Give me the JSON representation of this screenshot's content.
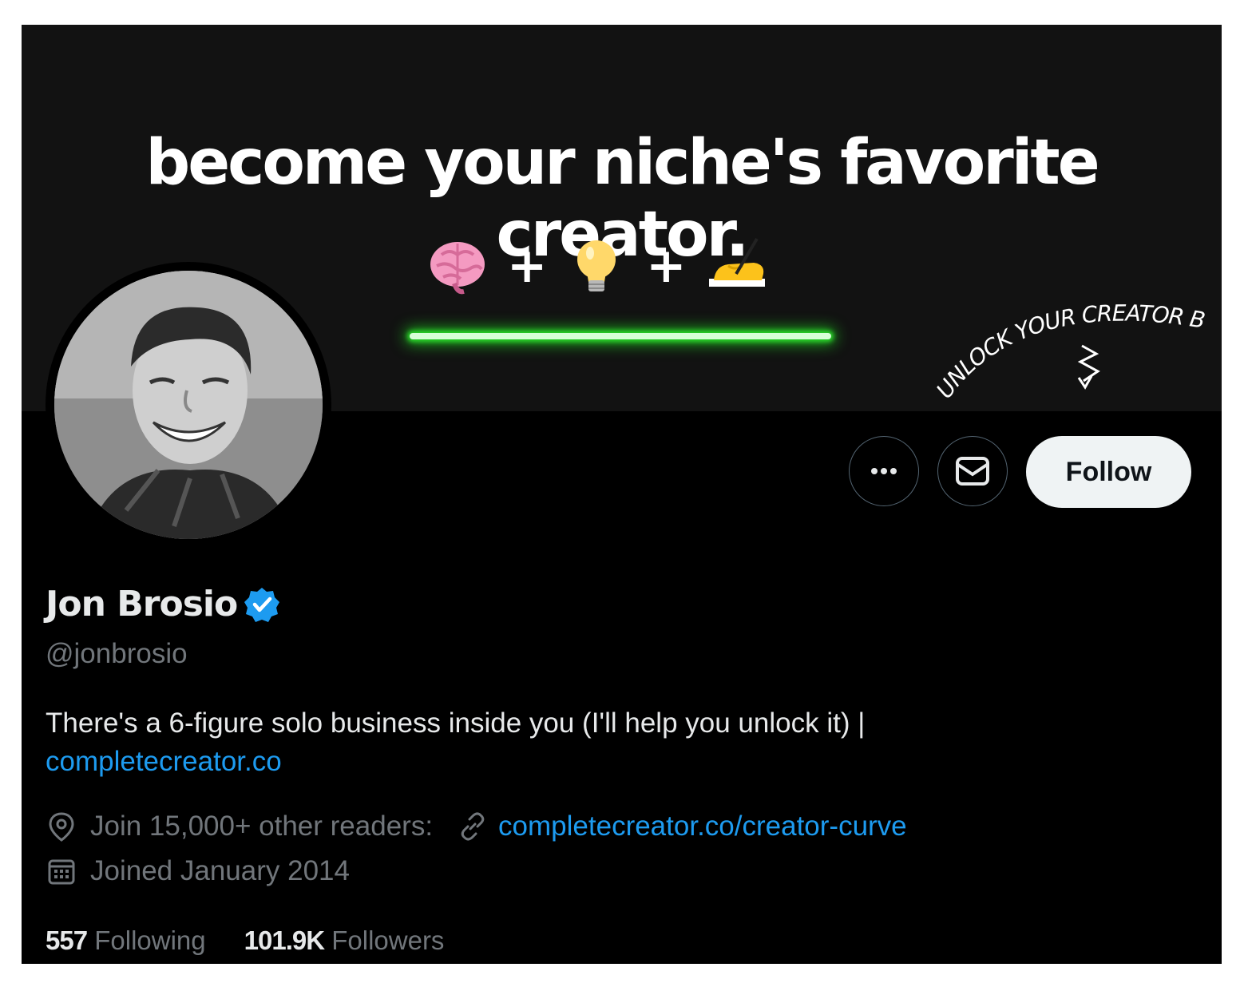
{
  "banner": {
    "headline": "become your niche's favorite creator.",
    "emoji_sequence": [
      "brain-emoji",
      "+",
      "light-bulb-emoji",
      "+",
      "writing-hand-emoji"
    ],
    "script_text": "UNLOCK YOUR CREATOR BUSINESS",
    "neon_color": "#2bd82b"
  },
  "actions": {
    "more_icon": "more-icon",
    "message_icon": "envelope-icon",
    "follow_label": "Follow"
  },
  "profile": {
    "name": "Jon Brosio",
    "verified_icon": "verified-badge-icon",
    "handle": "@jonbrosio",
    "bio_text": "There's a 6-figure solo business inside you (I'll help you unlock it) |",
    "bio_link": "completecreator.co",
    "location": "Join 15,000+ other readers:",
    "website": "completecreator.co/creator-curve",
    "joined": "Joined January 2014"
  },
  "stats": {
    "following_count": "557",
    "following_label": "Following",
    "followers_count": "101.9K",
    "followers_label": "Followers"
  },
  "colors": {
    "background": "#000000",
    "link": "#1d9bf0",
    "muted_text": "#71767b",
    "primary_text": "#e7e9ea",
    "verified": "#1d9bf0"
  }
}
